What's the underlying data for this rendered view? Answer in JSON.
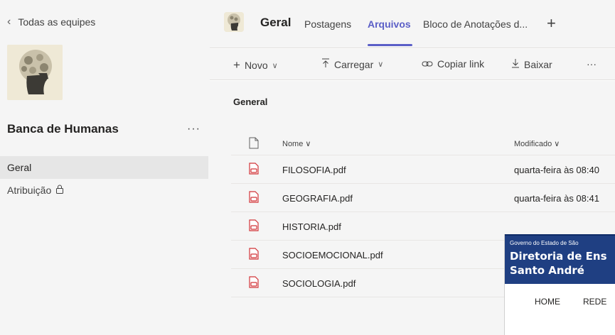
{
  "sidebar": {
    "back_label": "Todas as equipes",
    "team_name": "Banca de Humanas",
    "more_label": "···",
    "channels": [
      {
        "label": "Geral",
        "active": true,
        "locked": false
      },
      {
        "label": "Atribuição",
        "active": false,
        "locked": true
      }
    ]
  },
  "header": {
    "channel_title": "Geral",
    "tabs": [
      {
        "label": "Postagens",
        "active": false
      },
      {
        "label": "Arquivos",
        "active": true
      },
      {
        "label": "Bloco de Anotações d...",
        "active": false
      }
    ],
    "add_tab_label": "+"
  },
  "toolbar": {
    "new_label": "Novo",
    "upload_label": "Carregar",
    "copy_link_label": "Copiar link",
    "download_label": "Baixar",
    "more_label": "···"
  },
  "files": {
    "section_title": "General",
    "col_name": "Nome",
    "col_modified": "Modificado",
    "rows": [
      {
        "name": "FILOSOFIA.pdf",
        "modified": "quarta-feira às 08:40"
      },
      {
        "name": "GEOGRAFIA.pdf",
        "modified": "quarta-feira às 08:41"
      },
      {
        "name": "HISTORIA.pdf",
        "modified": ""
      },
      {
        "name": "SOCIOEMOCIONAL.pdf",
        "modified": ""
      },
      {
        "name": "SOCIOLOGIA.pdf",
        "modified": ""
      }
    ]
  },
  "overlay": {
    "gov_label": "Governo do Estado de São",
    "title_line1": "Diretoria de Ens",
    "title_line2": "Santo André",
    "nav_home": "HOME",
    "nav_rede": "REDE"
  },
  "colors": {
    "accent": "#5b5fc7",
    "pdf_red": "#d13438",
    "overlay_blue": "#1f3f82"
  }
}
